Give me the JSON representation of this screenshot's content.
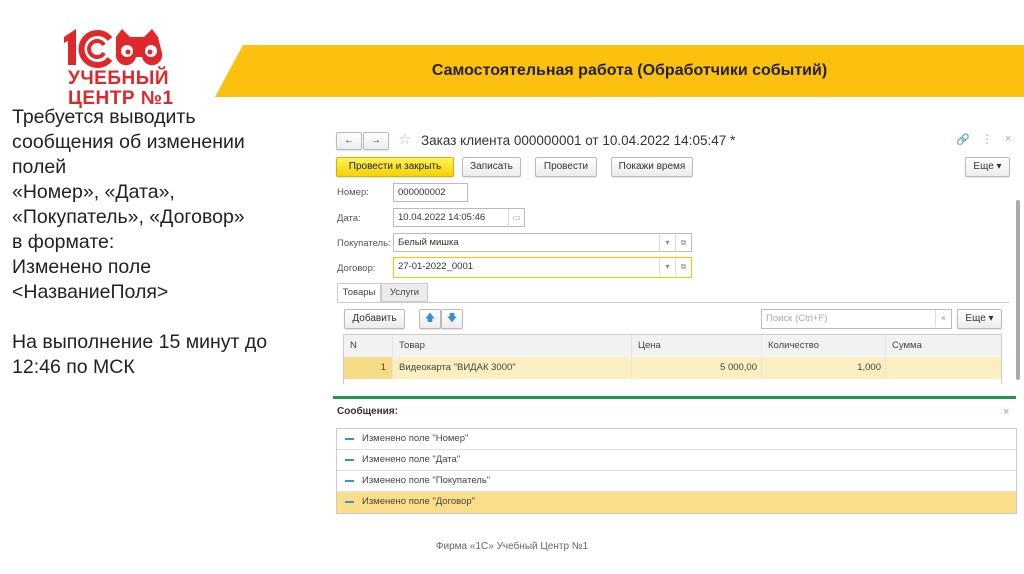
{
  "logo": {
    "mark": "1С",
    "line1": "УЧЕБНЫЙ",
    "line2": "ЦЕНТР №1"
  },
  "banner": {
    "title": "Самостоятельная работа (Обработчики событий)"
  },
  "task": {
    "lines": [
      "Требуется выводить",
      "сообщения об изменении",
      "полей",
      "«Номер», «Дата»,",
      "«Покупатель», «Договор»",
      "в формате:",
      "Изменено поле",
      "<НазваниеПоля>",
      "",
      "На выполнение 15 минут до",
      "12:46 по МСК"
    ]
  },
  "window": {
    "title": "Заказ клиента 000000001 от 10.04.2022 14:05:47 *",
    "buttons": {
      "post_close": "Провести и закрыть",
      "save": "Записать",
      "post": "Провести",
      "show_time": "Покажи время",
      "more": "Еще"
    },
    "fields": {
      "number": {
        "label": "Номер:",
        "value": "000000002"
      },
      "date": {
        "label": "Дата:",
        "value": "10.04.2022 14:05:46"
      },
      "buyer": {
        "label": "Покупатель:",
        "value": "Белый мишка"
      },
      "contract": {
        "label": "Договор:",
        "value": "27-01-2022_0001"
      }
    },
    "tabs": [
      "Товары",
      "Услуги"
    ],
    "table_toolbar": {
      "add": "Добавить",
      "search_placeholder": "Поиск (Ctrl+F)",
      "more": "Еще"
    },
    "table": {
      "headers": [
        "N",
        "Товар",
        "Цена",
        "Количество",
        "Сумма"
      ],
      "rows": [
        [
          "1",
          "Видеокарта \"ВИДАК 3000\"",
          "5 000,00",
          "1,000",
          ""
        ]
      ]
    }
  },
  "messages": {
    "title": "Сообщения:",
    "items": [
      "Изменено поле \"Номер\"",
      "Изменено поле \"Дата\"",
      "Изменено поле \"Покупатель\"",
      "Изменено поле \"Договор\""
    ]
  },
  "footer": "Фирма «1С» Учебный Центр №1"
}
